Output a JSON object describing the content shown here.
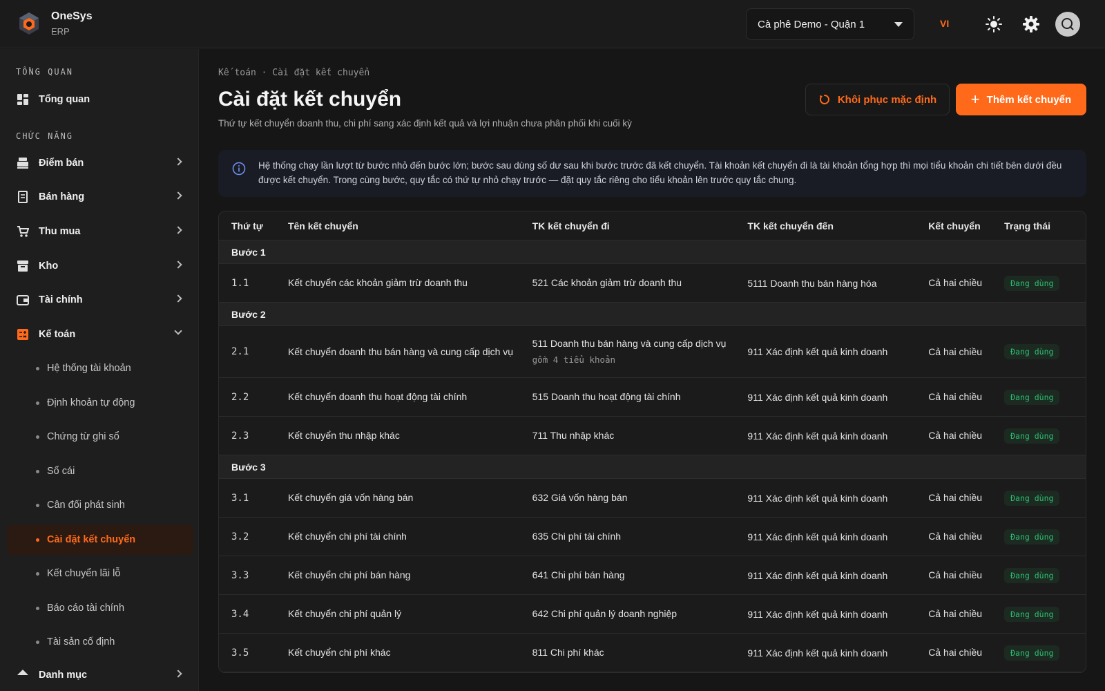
{
  "app": {
    "name": "OneSys",
    "sub": "ERP"
  },
  "header": {
    "store": "Cà phê Demo - Quận 1",
    "lang": "VI"
  },
  "sidebar": {
    "section_overview": "TỔNG QUAN",
    "overview_label": "Tổng quan",
    "section_functions": "CHỨC NĂNG",
    "items": [
      {
        "label": "Điểm bán"
      },
      {
        "label": "Bán hàng"
      },
      {
        "label": "Thu mua"
      },
      {
        "label": "Kho"
      },
      {
        "label": "Tài chính"
      },
      {
        "label": "Kế toán"
      }
    ],
    "sub_items": [
      {
        "label": "Hệ thống tài khoản"
      },
      {
        "label": "Định khoản tự động"
      },
      {
        "label": "Chứng từ ghi sổ"
      },
      {
        "label": "Sổ cái"
      },
      {
        "label": "Cân đối phát sinh"
      },
      {
        "label": "Cài đặt kết chuyển"
      },
      {
        "label": "Kết chuyển lãi lỗ"
      },
      {
        "label": "Báo cáo tài chính"
      },
      {
        "label": "Tài sản cố định"
      }
    ],
    "next_item": "Danh mục"
  },
  "page": {
    "breadcrumb": "Kế toán · Cài đặt kết chuyển",
    "title": "Cài đặt kết chuyển",
    "subtitle": "Thứ tự kết chuyển doanh thu, chi phí sang xác định kết quả và lợi nhuận chưa phân phối khi cuối kỳ",
    "restore_label": "Khôi phục mặc định",
    "add_label": "Thêm kết chuyển",
    "info": "Hệ thống chạy lần lượt từ bước nhỏ đến bước lớn; bước sau dùng số dư sau khi bước trước đã kết chuyển. Tài khoản kết chuyển đi là tài khoản tổng hợp thì mọi tiểu khoản chi tiết bên dưới đều được kết chuyển. Trong cùng bước, quy tắc có thứ tự nhỏ chạy trước — đặt quy tắc riêng cho tiểu khoản lên trước quy tắc chung."
  },
  "table": {
    "headers": [
      "Thứ tự",
      "Tên kết chuyển",
      "TK kết chuyển đi",
      "TK kết chuyển đến",
      "Kết chuyển",
      "Trạng thái"
    ],
    "groups": [
      {
        "label": "Bước 1",
        "rows": [
          {
            "order": "1.1",
            "name": "Kết chuyển các khoản giảm trừ doanh thu",
            "from": "521 Các khoản giảm trừ doanh thu",
            "to": "5111 Doanh thu bán hàng hóa",
            "dir": "Cả hai chiều",
            "status": "Đang dùng"
          }
        ]
      },
      {
        "label": "Bước 2",
        "rows": [
          {
            "order": "2.1",
            "name": "Kết chuyển doanh thu bán hàng và cung cấp dịch vụ",
            "from": "511 Doanh thu bán hàng và cung cấp dịch vụ",
            "note": "gồm 4 tiểu khoản",
            "to": "911 Xác định kết quả kinh doanh",
            "dir": "Cả hai chiều",
            "status": "Đang dùng"
          },
          {
            "order": "2.2",
            "name": "Kết chuyển doanh thu hoạt động tài chính",
            "from": "515 Doanh thu hoạt động tài chính",
            "to": "911 Xác định kết quả kinh doanh",
            "dir": "Cả hai chiều",
            "status": "Đang dùng"
          },
          {
            "order": "2.3",
            "name": "Kết chuyển thu nhập khác",
            "from": "711 Thu nhập khác",
            "to": "911 Xác định kết quả kinh doanh",
            "dir": "Cả hai chiều",
            "status": "Đang dùng"
          }
        ]
      },
      {
        "label": "Bước 3",
        "rows": [
          {
            "order": "3.1",
            "name": "Kết chuyển giá vốn hàng bán",
            "from": "632 Giá vốn hàng bán",
            "to": "911 Xác định kết quả kinh doanh",
            "dir": "Cả hai chiều",
            "status": "Đang dùng"
          },
          {
            "order": "3.2",
            "name": "Kết chuyển chi phí tài chính",
            "from": "635 Chi phí tài chính",
            "to": "911 Xác định kết quả kinh doanh",
            "dir": "Cả hai chiều",
            "status": "Đang dùng"
          },
          {
            "order": "3.3",
            "name": "Kết chuyển chi phí bán hàng",
            "from": "641 Chi phí bán hàng",
            "to": "911 Xác định kết quả kinh doanh",
            "dir": "Cả hai chiều",
            "status": "Đang dùng"
          },
          {
            "order": "3.4",
            "name": "Kết chuyển chi phí quản lý",
            "from": "642 Chi phí quản lý doanh nghiệp",
            "to": "911 Xác định kết quả kinh doanh",
            "dir": "Cả hai chiều",
            "status": "Đang dùng"
          },
          {
            "order": "3.5",
            "name": "Kết chuyển chi phí khác",
            "from": "811 Chi phí khác",
            "to": "911 Xác định kết quả kinh doanh",
            "dir": "Cả hai chiều",
            "status": "Đang dùng"
          }
        ]
      }
    ]
  },
  "colors": {
    "accent": "#ff6a1a",
    "active_badge": "#2fbf71"
  },
  "icons": [
    "logo-icon",
    "caret-down-icon",
    "sun-icon",
    "gear-icon",
    "avatar-icon",
    "grid-icon",
    "cash-register-icon",
    "receipt-icon",
    "cart-icon",
    "archive-icon",
    "wallet-icon",
    "calculator-icon",
    "restore-icon",
    "plus-icon",
    "info-icon"
  ]
}
